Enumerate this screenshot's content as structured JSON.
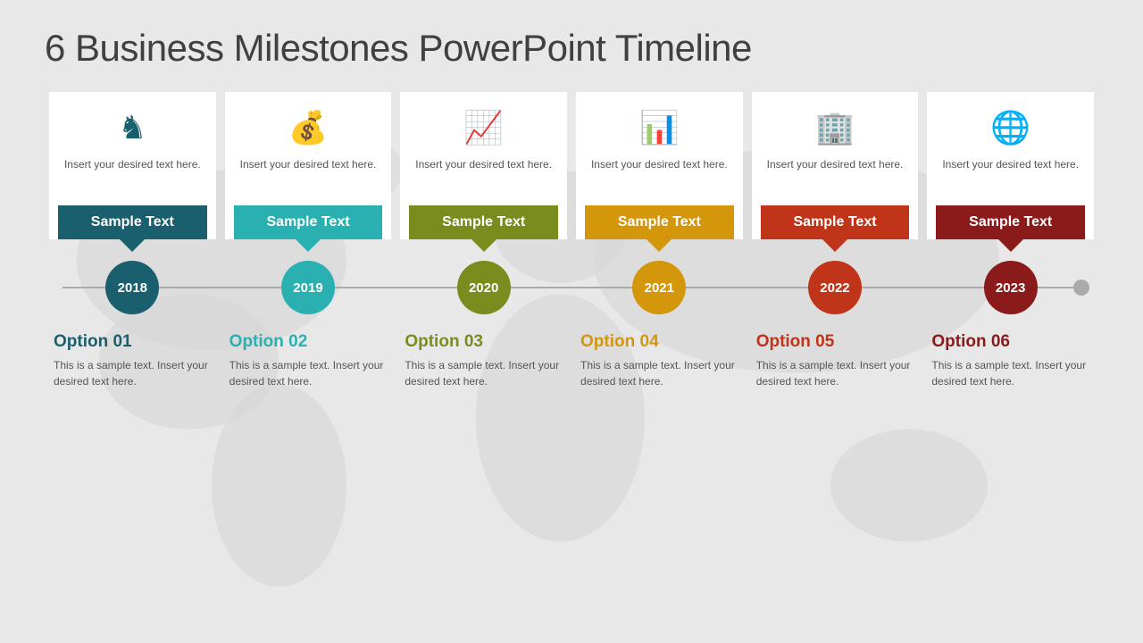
{
  "title": "6 Business Milestones PowerPoint Timeline",
  "cards": [
    {
      "id": 1,
      "icon": "♞",
      "icon_color": "#1a5f6e",
      "card_text": "Insert your desired text here.",
      "label": "Sample Text",
      "label_bg": "#1a5f6e",
      "year": "2018",
      "dot_bg": "#1a5f6e",
      "option_title": "Option 01",
      "option_title_color": "#1a5f6e",
      "option_text": "This is a sample text. Insert your desired text here."
    },
    {
      "id": 2,
      "icon": "💰",
      "icon_color": "#2ab0b0",
      "card_text": "Insert your desired text here.",
      "label": "Sample Text",
      "label_bg": "#2ab0b0",
      "year": "2019",
      "dot_bg": "#2ab0b0",
      "option_title": "Option 02",
      "option_title_color": "#2ab0b0",
      "option_text": "This is a sample text. Insert your desired text here."
    },
    {
      "id": 3,
      "icon": "📈",
      "icon_color": "#7a8c1e",
      "card_text": "Insert your desired text here.",
      "label": "Sample Text",
      "label_bg": "#7a8c1e",
      "year": "2020",
      "dot_bg": "#7a8c1e",
      "option_title": "Option 03",
      "option_title_color": "#7a8c1e",
      "option_text": "This is a sample text. Insert your desired text here."
    },
    {
      "id": 4,
      "icon": "📊",
      "icon_color": "#d4960a",
      "card_text": "Insert your desired text here.",
      "label": "Sample Text",
      "label_bg": "#d4960a",
      "year": "2021",
      "dot_bg": "#d4960a",
      "option_title": "Option 04",
      "option_title_color": "#d4960a",
      "option_text": "This is a sample text. Insert your desired text here."
    },
    {
      "id": 5,
      "icon": "🏢",
      "icon_color": "#c0351a",
      "card_text": "Insert your desired text here.",
      "label": "Sample Text",
      "label_bg": "#c0351a",
      "year": "2022",
      "dot_bg": "#c0351a",
      "option_title": "Option 05",
      "option_title_color": "#c0351a",
      "option_text": "This is a sample text. Insert your desired text here."
    },
    {
      "id": 6,
      "icon": "🌐",
      "icon_color": "#8b1a1a",
      "card_text": "Insert your desired text here.",
      "label": "Sample Text",
      "label_bg": "#8b1a1a",
      "year": "2023",
      "dot_bg": "#8b1a1a",
      "option_title": "Option 06",
      "option_title_color": "#8b1a1a",
      "option_text": "This is a sample text. Insert your desired text here."
    }
  ]
}
